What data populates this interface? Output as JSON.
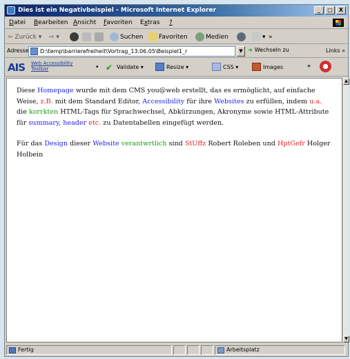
{
  "window": {
    "title": "Dies ist ein Negativbeispiel - Microsoft Internet Explorer",
    "controls": [
      "_",
      "□",
      "X"
    ]
  },
  "menubar": {
    "items": [
      {
        "u": "D",
        "rest": "atei"
      },
      {
        "u": "B",
        "rest": "earbeiten"
      },
      {
        "u": "A",
        "rest": "nsicht"
      },
      {
        "u": "F",
        "rest": "avoriten"
      },
      {
        "pre": "E",
        "u": "x",
        "rest": "tras"
      },
      {
        "u": "?",
        "rest": ""
      }
    ]
  },
  "toolbar": {
    "back_label": "Zurück",
    "search_label": "Suchen",
    "favorites_label": "Favoriten",
    "media_label": "Medien"
  },
  "addressbar": {
    "label": "Adresse",
    "url": "D:\\temp\\barrierefreiheit\\Vortrag_13.06.05\\Beispiel1_r",
    "go_label": "Wechseln zu",
    "links_label": "Links »"
  },
  "ais_toolbar": {
    "logo": "AIS",
    "sub_line1": "Web Accessibility",
    "sub_line2": "Toolbar",
    "validate_label": "Validate",
    "resize_label": "Resize",
    "css_label": "CSS",
    "images_label": "Images"
  },
  "content": {
    "p1": {
      "t1": "Diese ",
      "homepage": "Homepage",
      "t2": " wurde mit dem CMS you@web erstellt, das es ermöglicht, auf einfache Weise, ",
      "zb": "z.B.",
      "t3": " mit dem Standard Editor, ",
      "accessibility": "Accessibility",
      "t4": " für ihre ",
      "websites": "Websites",
      "t5": " zu erfüllen, indem ",
      "ua": "u.a.",
      "t6": " die ",
      "korrkten": "korrkten",
      "t7": " HTML-Tags für Sprachwechsel, Abkürzungen, Akronyme sowie HTML-Attribute für ",
      "summary_header": "summary, header",
      "t8": " ",
      "etc": "etc.",
      "t9": " zu Datentabellen eingefügt werden."
    },
    "p2": {
      "t1": "Für das ",
      "design": "Design",
      "t2": " dieser ",
      "website": "Website",
      "t3": " ",
      "verantwrtlich": "verantwrtlich",
      "t4": " sind ",
      "stuffz": "StUffz",
      "t5": " Robert Roleben und ",
      "hptgefr": "HptGefr",
      "t6": " Holger Holbein"
    }
  },
  "statusbar": {
    "status": "Fertig",
    "zone": "Arbeitsplatz"
  }
}
